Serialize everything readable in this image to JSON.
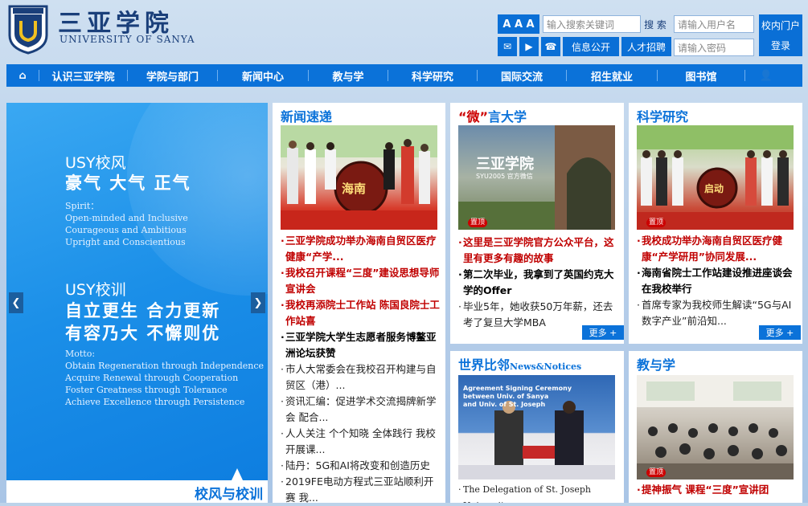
{
  "header": {
    "brand_cn": "三亚学院",
    "brand_en": "UNIVERSITY OF SANYA",
    "font_size_label": "A A A",
    "search_placeholder": "输入搜索关键词",
    "search_button": "搜 索",
    "username_placeholder": "请输入用户名",
    "password_placeholder": "请输入密码",
    "portal_label": "校内门户",
    "login_label": "登录",
    "info_public": "信息公开",
    "recruit": "人才招聘"
  },
  "nav": {
    "items": [
      "认识三亚学院",
      "学院与部门",
      "新闻中心",
      "教与学",
      "科学研究",
      "国际交流",
      "招生就业",
      "图书馆"
    ]
  },
  "banner": {
    "style_title": "USY校风",
    "style_big": "豪气 大气 正气",
    "spirit_en": "Spirit：\nOpen-minded and Inclusive\nCourageous and Ambitious\nUpright and Conscientious",
    "motto_title": "USY校训",
    "motto_big_1": "自立更生 合力更新",
    "motto_big_2": "有容乃大 不懈则优",
    "motto_en": "Motto:\nObtain Regeneration through Independence\nAcquire Renewal through Cooperation\nFoster Greatness through Tolerance\nAchieve Excellence through Persistence",
    "tab_label": "校风与校训",
    "prev": "❮",
    "next": "❯"
  },
  "news_panel": {
    "title": "新闻速递",
    "photo_text": "海南",
    "items": [
      {
        "text": "三亚学院成功举办海南自贸区医疗健康“产学...",
        "style": "red"
      },
      {
        "text": "我校召开课程“三度”建设思想导师宣讲会",
        "style": "red"
      },
      {
        "text": "我校再添院士工作站 陈国良院士工作站喜",
        "style": "red"
      },
      {
        "text": "三亚学院大学生志愿者服务博鳌亚洲论坛获赞",
        "style": "blk"
      },
      {
        "text": "市人大常委会在我校召开构建与自贸区（港）...",
        "style": "nrm"
      },
      {
        "text": "资讯汇编：促进学术交流揭牌新学会 配合...",
        "style": "nrm"
      },
      {
        "text": "人人关注 个个知晓 全体践行 我校开展课...",
        "style": "nrm"
      },
      {
        "text": "陆丹：5G和AI将改变和创造历史",
        "style": "nrm"
      },
      {
        "text": "2019FE电动方程式三亚站顺利开赛 我...",
        "style": "nrm"
      }
    ]
  },
  "wei_panel": {
    "title_prefix": "“微”",
    "title_rest": "言大学",
    "photo_text": "三亚学院",
    "photo_sub": "SYU2005 官方微信",
    "top_tag": "置顶",
    "items": [
      {
        "text": "这里是三亚学院官方公众平台，这里有更多有趣的故事",
        "style": "red"
      },
      {
        "text": "第二次毕业，我拿到了英国约克大学的Offer",
        "style": "blk"
      },
      {
        "text": "毕业5年，她收获50万年薪，还去考了复旦大学MBA",
        "style": "nrm"
      }
    ],
    "more": "更多 +"
  },
  "sci_panel": {
    "title": "科学研究",
    "photo_text": "启动",
    "top_tag": "置顶",
    "items": [
      {
        "text": "我校成功举办海南自贸区医疗健康“产学研用”协同发展...",
        "style": "red"
      },
      {
        "text": "海南省院士工作站建设推进座谈会在我校举行",
        "style": "blk"
      },
      {
        "text": "首席专家为我校师生解读“5G与AI数字产业”前沿知...",
        "style": "nrm"
      }
    ],
    "more": "更多 +"
  },
  "world_panel": {
    "title": "世界比邻",
    "title_en": "News&Notices",
    "photo_text_1": "Agreement Signing Ceremony",
    "photo_text_2": "between Univ. of Sanya",
    "photo_text_3": "and Univ. of St. Joseph",
    "items": [
      {
        "text": "The Delegation of St. Joseph University",
        "style": "nrm"
      }
    ]
  },
  "teach_panel": {
    "title": "教与学",
    "top_tag": "置顶",
    "items": [
      {
        "text": "提神振气 课程“三度”宣讲团",
        "style": "red"
      }
    ]
  }
}
